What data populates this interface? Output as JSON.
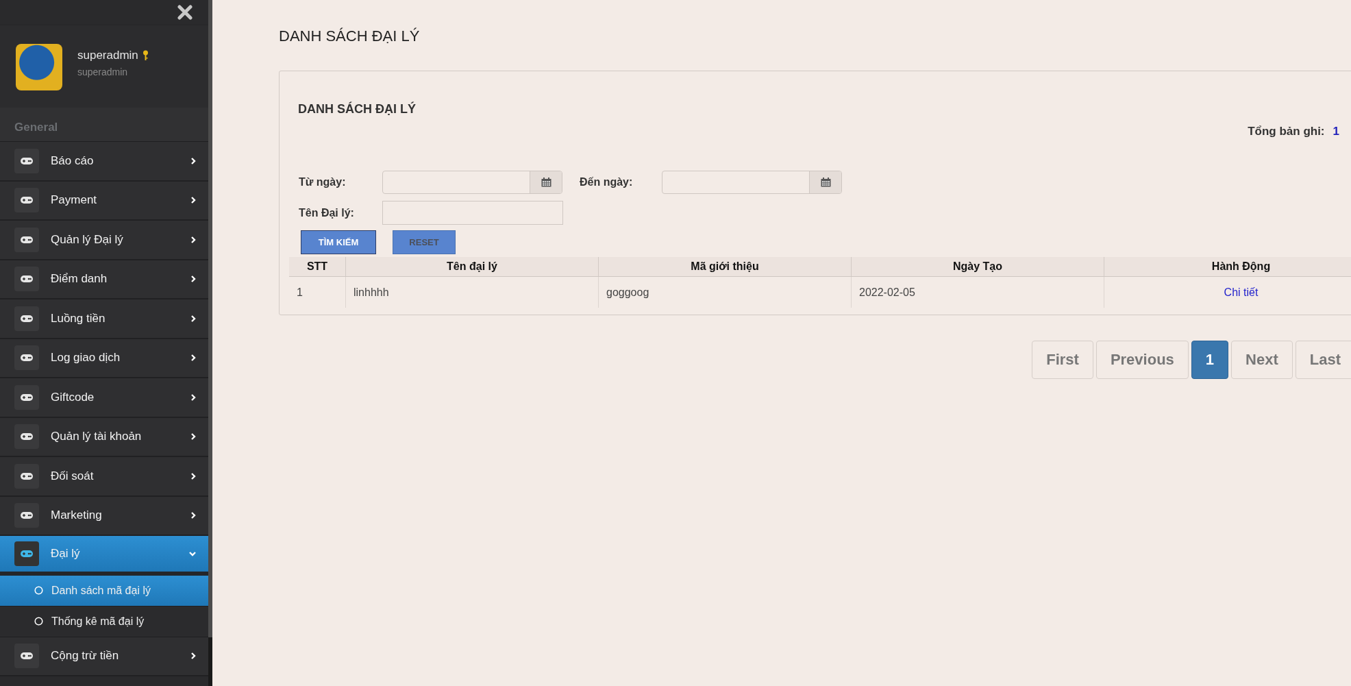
{
  "sidebar": {
    "user": {
      "name": "superadmin",
      "role": "superadmin"
    },
    "section": "General",
    "items": [
      {
        "label": "Báo cáo",
        "expanded": false,
        "selected": false
      },
      {
        "label": "Payment",
        "expanded": false,
        "selected": false
      },
      {
        "label": "Quản lý Đại lý",
        "expanded": false,
        "selected": false
      },
      {
        "label": "Điểm danh",
        "expanded": false,
        "selected": false
      },
      {
        "label": "Luồng tiền",
        "expanded": false,
        "selected": false
      },
      {
        "label": "Log giao dịch",
        "expanded": false,
        "selected": false
      },
      {
        "label": "Giftcode",
        "expanded": false,
        "selected": false
      },
      {
        "label": "Quản lý tài khoản",
        "expanded": false,
        "selected": false
      },
      {
        "label": "Đối soát",
        "expanded": false,
        "selected": false
      },
      {
        "label": "Marketing",
        "expanded": false,
        "selected": false
      },
      {
        "label": "Đại lý",
        "expanded": true,
        "selected": true,
        "children": [
          {
            "label": "Danh sách mã đại lý",
            "selected": true
          },
          {
            "label": "Thống kê mã đại lý",
            "selected": false
          }
        ]
      },
      {
        "label": "Cộng trừ tiền",
        "expanded": false,
        "selected": false
      }
    ]
  },
  "page_title": "DANH SÁCH ĐẠI LÝ",
  "card": {
    "title": "DANH SÁCH ĐẠI LÝ",
    "total_label": "Tổng bản ghi:",
    "total_value": "1",
    "filters": {
      "from_label": "Từ ngày:",
      "to_label": "Đến ngày:",
      "name_label": "Tên Đại lý:"
    },
    "buttons": [
      "TÌM KIẾM",
      "RESET"
    ],
    "table": {
      "columns": [
        "STT",
        "Tên đại lý",
        "Mã giới thiệu",
        "Ngày Tạo",
        "Hành Động"
      ],
      "rows": [
        {
          "cells": [
            "1",
            "linhhhh",
            "goggoog",
            "2022-02-05"
          ],
          "action": "Chi tiết"
        }
      ]
    }
  },
  "pagination": [
    {
      "label": "First",
      "selected": false
    },
    {
      "label": "Previous",
      "selected": false
    },
    {
      "label": "1",
      "selected": true
    },
    {
      "label": "Next",
      "selected": false
    },
    {
      "label": "Last",
      "selected": false
    }
  ]
}
